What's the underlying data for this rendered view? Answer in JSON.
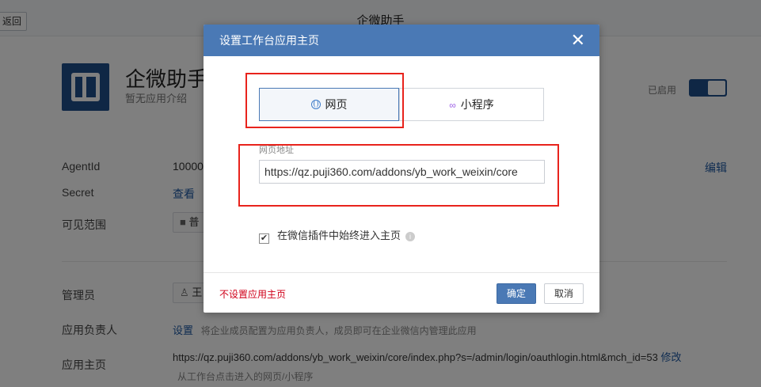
{
  "topbar": {
    "back_label": "返回",
    "title": "企微助手"
  },
  "app": {
    "name": "企微助手",
    "description": "暂无应用介绍",
    "status_label": "已启用"
  },
  "info": {
    "agentid_label": "AgentId",
    "agentid_value": "10000",
    "secret_label": "Secret",
    "secret_link": "查看",
    "visible_label": "可见范围",
    "visible_value": "普",
    "edit_label": "编辑",
    "admin_label": "管理员",
    "admin_value": "王",
    "owner_label": "应用负责人",
    "owner_link": "设置",
    "owner_hint": "将企业成员配置为应用负责人，成员即可在企业微信内管理此应用",
    "homepage_label": "应用主页",
    "homepage_url": "https://qz.puji360.com/addons/yb_work_weixin/core/index.php?s=/admin/login/oauthlogin.html&mch_id=53",
    "homepage_edit": "修改",
    "homepage_hint": "从工作台点击进入的网页/小程序"
  },
  "modal": {
    "title": "设置工作台应用主页",
    "tab_web": "网页",
    "tab_mini": "小程序",
    "field_label": "网页地址",
    "url_value": "https://qz.puji360.com/addons/yb_work_weixin/core",
    "checkbox_label": "在微信插件中始终进入主页",
    "no_home_label": "不设置应用主页",
    "ok_label": "确定",
    "cancel_label": "取消"
  },
  "colors": {
    "accent": "#4a79b5",
    "brand": "#1e4f8a",
    "highlight": "#e8231c",
    "danger": "#d0021b"
  },
  "icons": {
    "close": "close-icon",
    "web": "globe-icon",
    "mini": "mini-program-icon",
    "info": "info-icon",
    "folder": "folder-icon",
    "user": "user-icon"
  }
}
